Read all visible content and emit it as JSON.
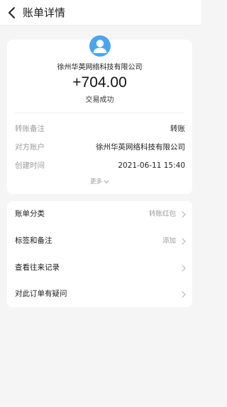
{
  "header": {
    "title": "账单详情",
    "back_icon": "chevron-left-icon"
  },
  "summary": {
    "avatar_icon": "user-avatar-icon",
    "payee": "徐州华英网络科技有限公司",
    "amount": "+704.00",
    "status": "交易成功"
  },
  "details": {
    "rows": [
      {
        "key": "转账备注",
        "value": "转账"
      },
      {
        "key": "对方账户",
        "value": "徐州华英网络科技有限公司"
      },
      {
        "key": "创建时间",
        "value": "2021-06-11 15:40"
      }
    ],
    "more_label": "更多"
  },
  "list": {
    "items": [
      {
        "label": "账单分类",
        "value": "转账红包"
      },
      {
        "label": "标签和备注",
        "value": "添加"
      },
      {
        "label": "查看往来记录",
        "value": ""
      },
      {
        "label": "对此订单有疑问",
        "value": ""
      }
    ]
  },
  "colors": {
    "background": "#f5f5f5",
    "card": "#ffffff",
    "avatar": "#4aa5f0",
    "muted_text": "#9a9a9a"
  }
}
